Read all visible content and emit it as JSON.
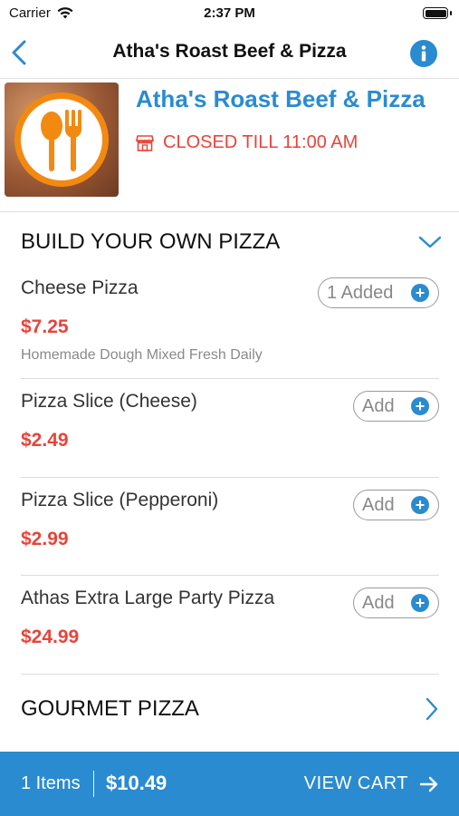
{
  "status_bar": {
    "carrier": "Carrier",
    "time": "2:37 PM"
  },
  "nav": {
    "title": "Atha's Roast Beef & Pizza",
    "back_icon": "chevron-left-icon",
    "info_icon": "info-icon"
  },
  "restaurant": {
    "name": "Atha's Roast Beef & Pizza",
    "status": "CLOSED TILL 11:00 AM",
    "status_color": "#e8443a",
    "accent_color": "#2a8bd0"
  },
  "categories": [
    {
      "title": "BUILD YOUR OWN PIZZA",
      "expanded": true,
      "items": [
        {
          "name": "Cheese Pizza",
          "price": "$7.25",
          "description": "Homemade Dough Mixed Fresh Daily",
          "button": "1 Added"
        },
        {
          "name": "Pizza Slice (Cheese)",
          "price": "$2.49",
          "button": "Add"
        },
        {
          "name": "Pizza Slice (Pepperoni)",
          "price": "$2.99",
          "button": "Add"
        },
        {
          "name": "Athas Extra Large Party Pizza",
          "price": "$24.99",
          "button": "Add"
        }
      ]
    },
    {
      "title": "GOURMET PIZZA",
      "expanded": false
    }
  ],
  "cart": {
    "items": "1 Items",
    "total": "$10.49",
    "view_label": "VIEW CART"
  }
}
